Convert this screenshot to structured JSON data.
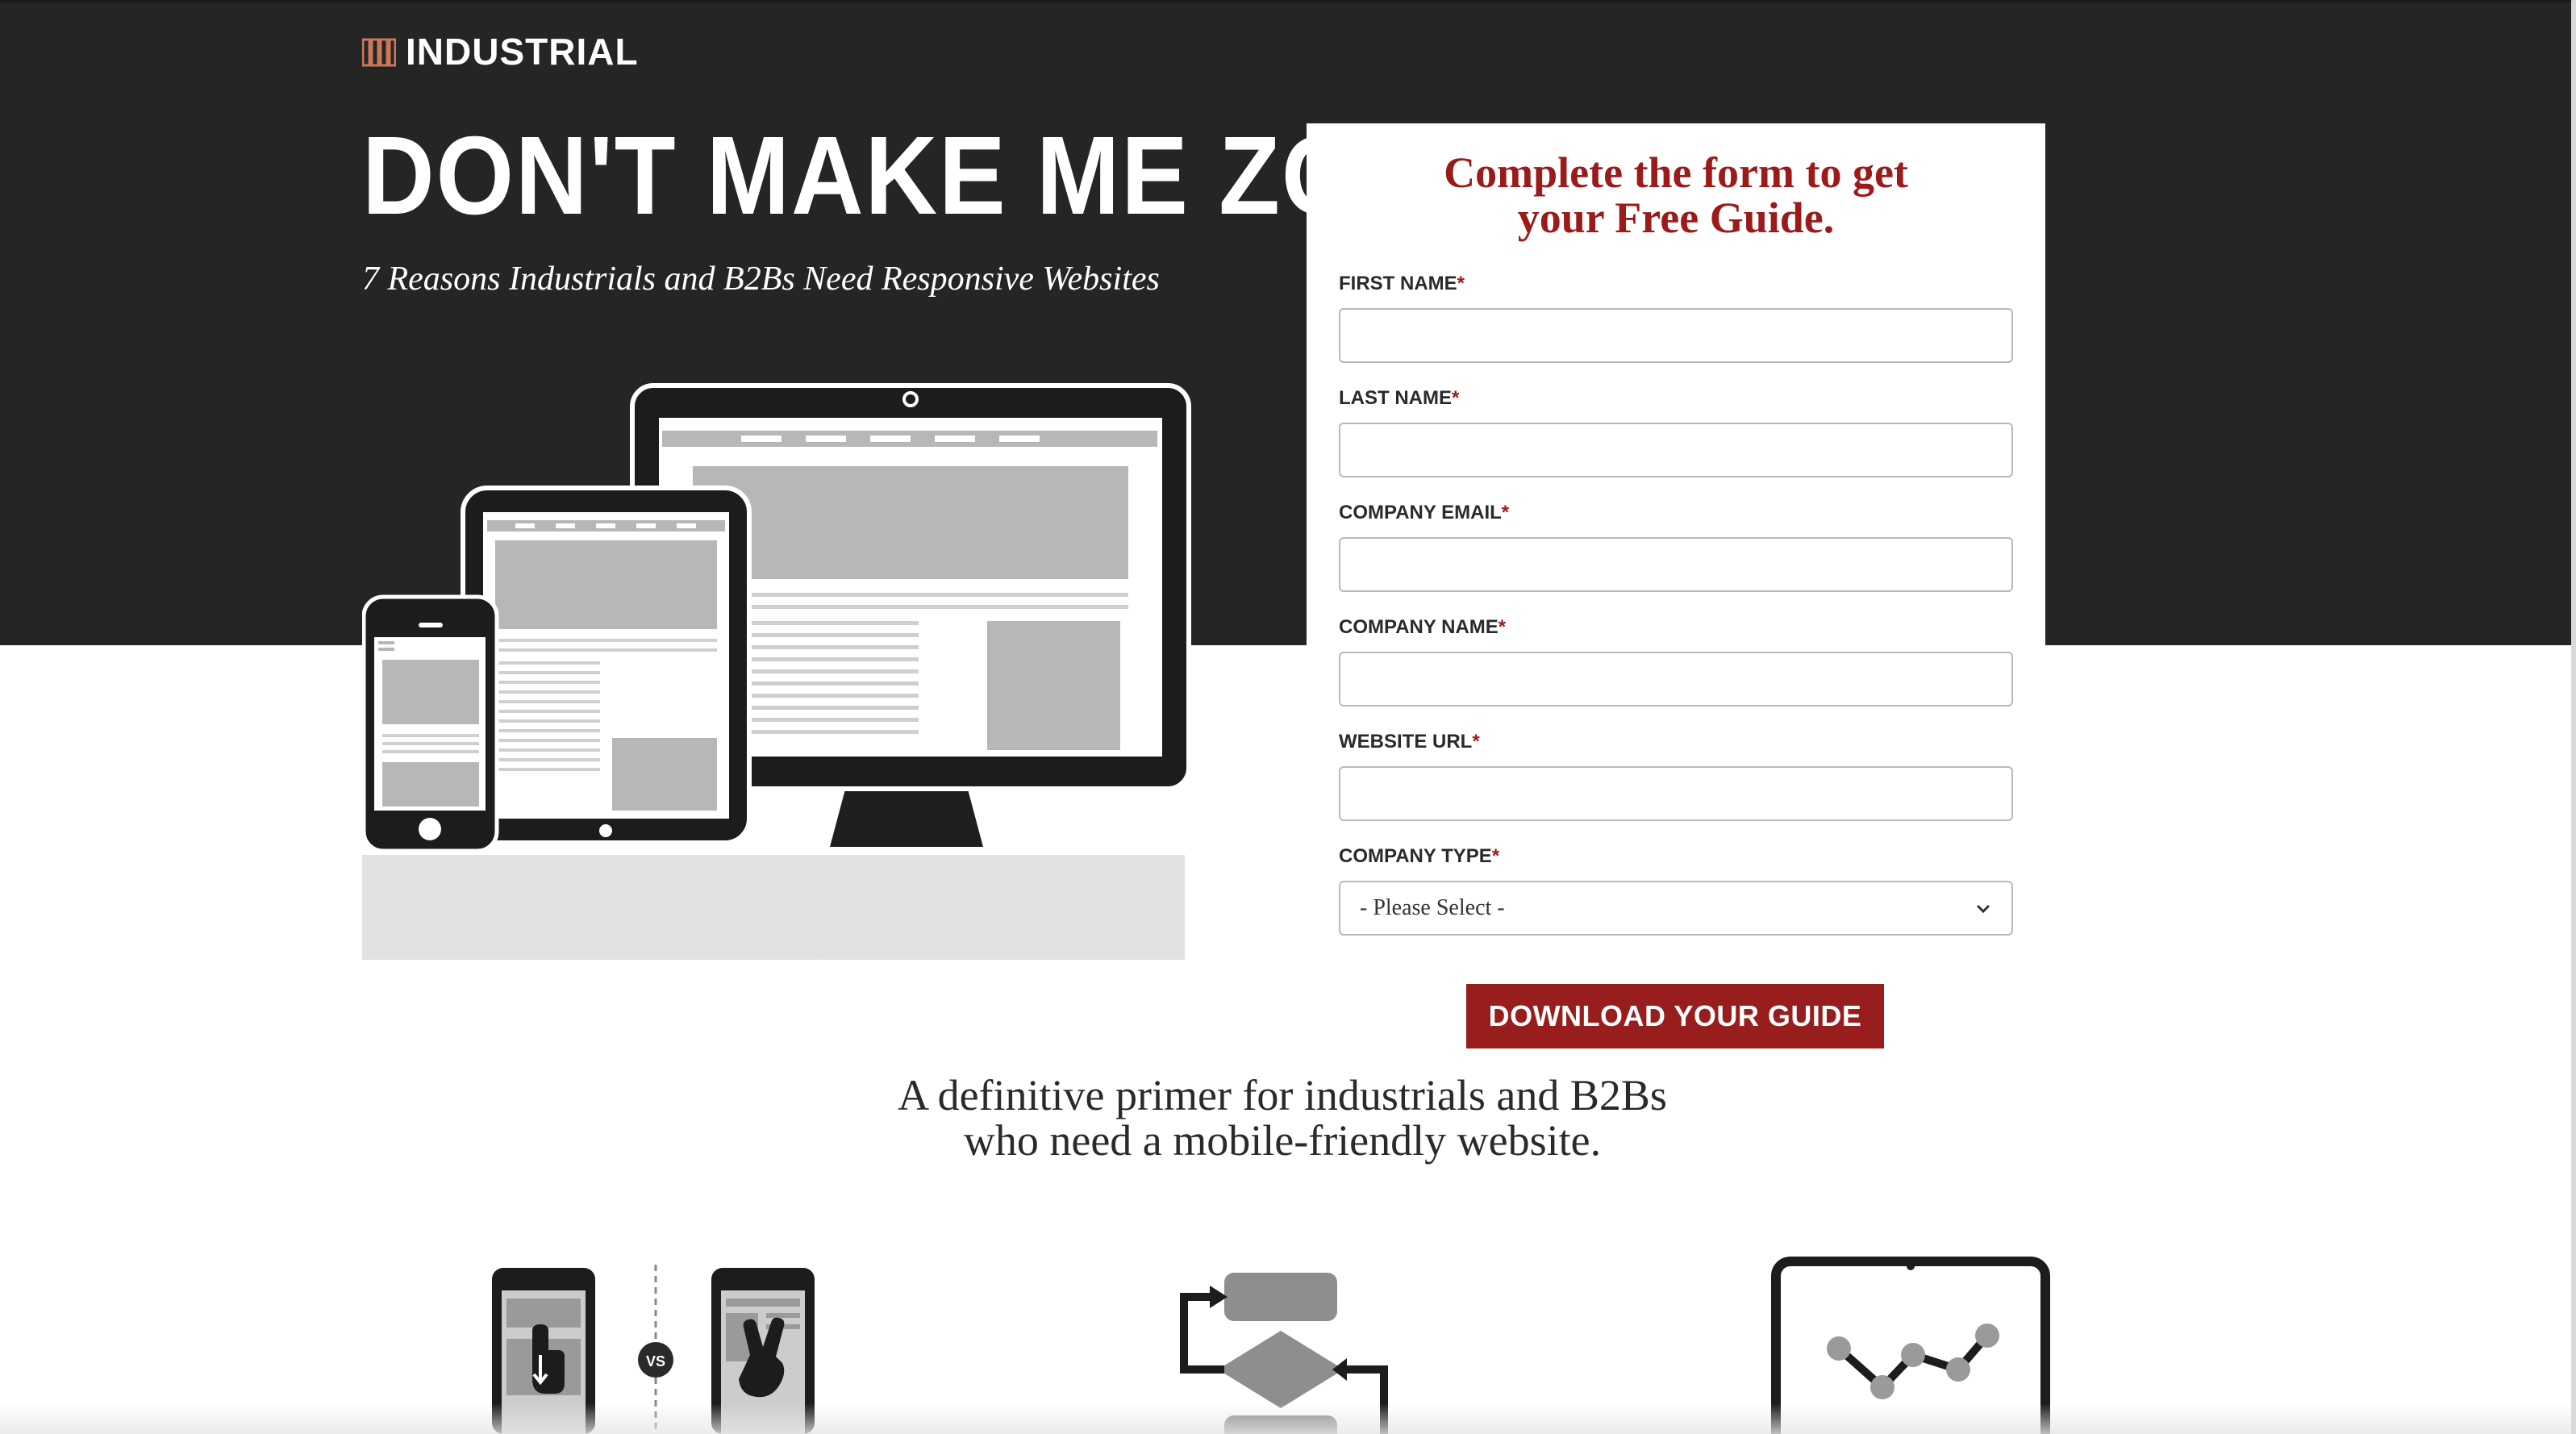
{
  "brand": {
    "name": "INDUSTRIAL",
    "accent": "#c9785a"
  },
  "hero": {
    "title": "DON'T MAKE ME ZOOM",
    "subtitle": "7 Reasons Industrials and B2Bs Need Responsive Websites"
  },
  "form": {
    "heading_line1": "Complete the form to get",
    "heading_line2": "your Free Guide.",
    "required_mark": "*",
    "fields": [
      {
        "label": "FIRST NAME",
        "value": ""
      },
      {
        "label": "LAST NAME",
        "value": ""
      },
      {
        "label": "COMPANY EMAIL",
        "value": ""
      },
      {
        "label": "COMPANY NAME",
        "value": ""
      },
      {
        "label": "WEBSITE URL",
        "value": ""
      },
      {
        "label": "COMPANY TYPE",
        "selected": "- Please Select -"
      }
    ],
    "submit_label": "DOWNLOAD YOUR GUIDE"
  },
  "primer": {
    "line1": "A definitive primer for industrials and B2Bs",
    "line2": "who need a mobile-friendly website."
  },
  "features": {
    "vs_label": "VS",
    "icons": [
      "touch-vs-pinch-icon",
      "flowchart-icon",
      "tablet-chart-icon"
    ]
  },
  "colors": {
    "dark_bg": "#252525",
    "accent_red": "#981e1e",
    "heading_red": "#9b1b1b"
  }
}
